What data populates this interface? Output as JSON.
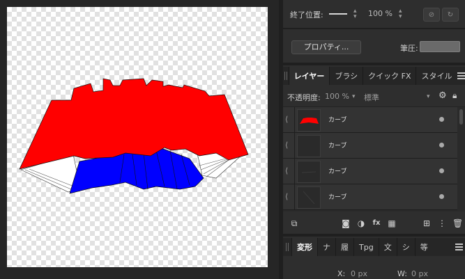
{
  "brush": {
    "end_position_label": "終了位置:",
    "end_position_value": "100 %",
    "properties_button": "プロパティ...",
    "pressure_label": "筆圧:"
  },
  "layers_panel": {
    "tabs": [
      "レイヤー",
      "ブラシ",
      "クイック FX",
      "スタイル"
    ],
    "opacity_label": "不透明度:",
    "opacity_value": "100 %",
    "blend_mode": "標準",
    "layers": [
      {
        "name": "カーブ",
        "visible": true
      },
      {
        "name": "カーブ",
        "visible": true
      },
      {
        "name": "カーブ",
        "visible": true
      },
      {
        "name": "カーブ",
        "visible": true
      }
    ]
  },
  "transform_panel": {
    "tabs": [
      "変形",
      "ナ",
      "履",
      "Tpg",
      "文",
      "シ",
      "等"
    ],
    "x_label": "X:",
    "x_value": "0 px",
    "w_label": "W:",
    "w_value": "0 px"
  },
  "colors": {
    "red_shape": "#ff0000",
    "blue_shape": "#0000ff",
    "panel_bg": "#2e2e2e",
    "canvas_bg": "#262626"
  }
}
